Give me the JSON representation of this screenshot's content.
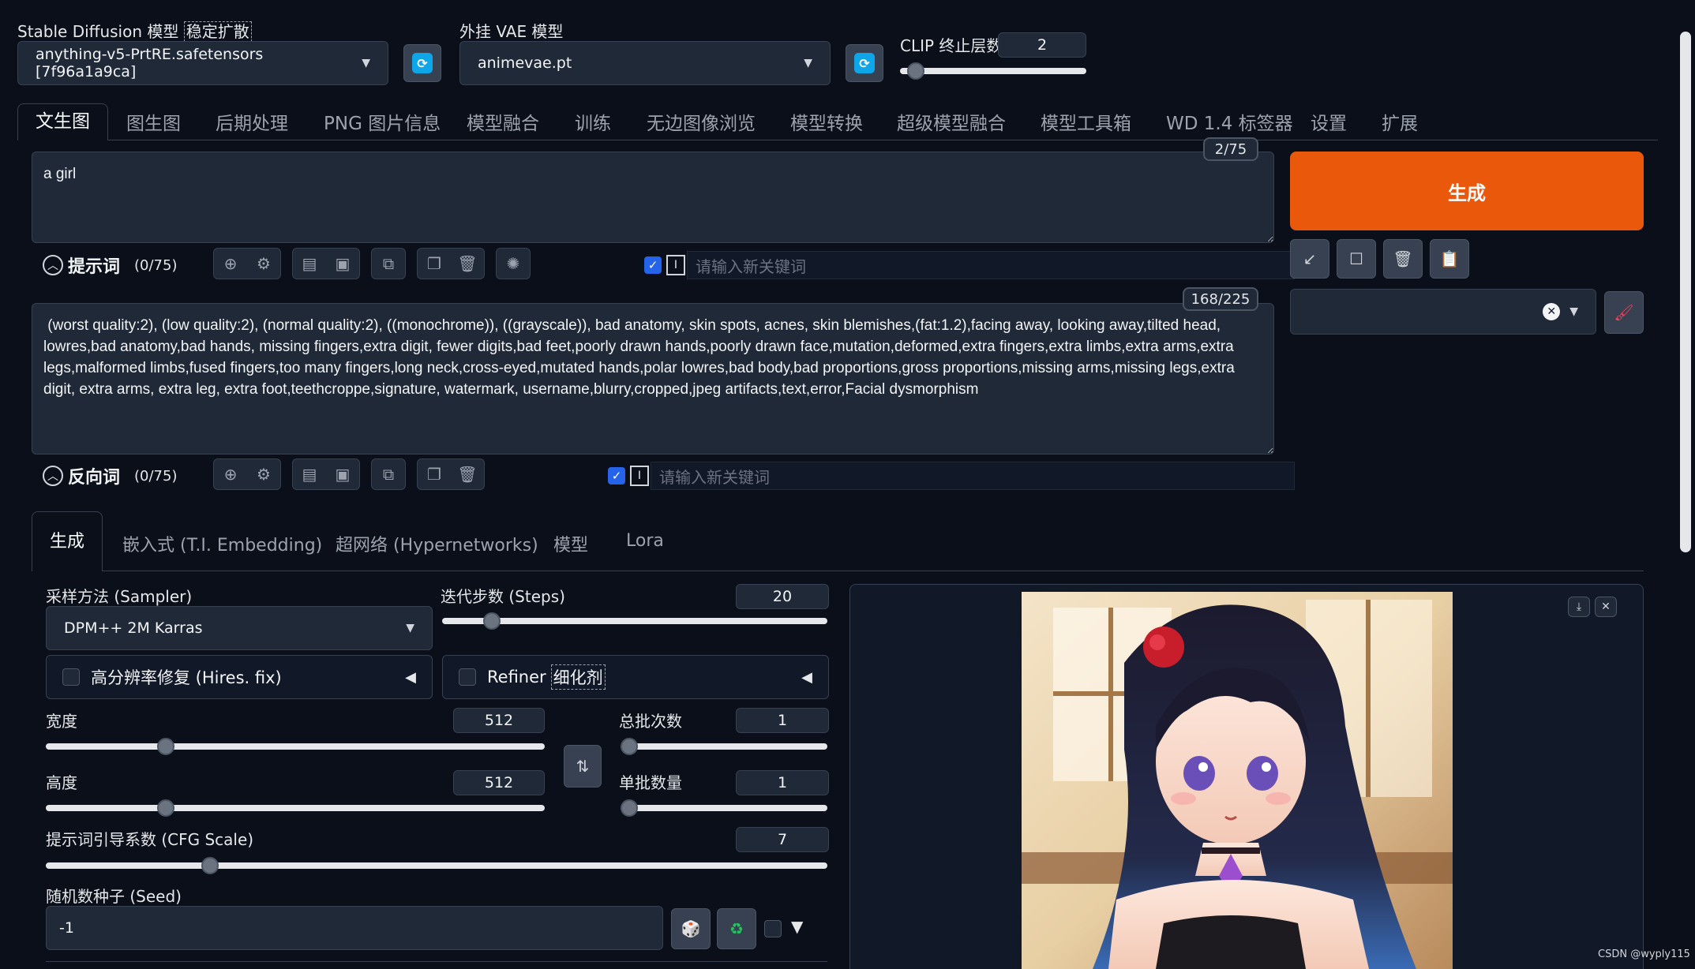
{
  "top": {
    "sd_model_label": "Stable Diffusion 模型",
    "sd_model_label_tag": "稳定扩散",
    "sd_model_value": "anything-v5-PrtRE.safetensors [7f96a1a9ca]",
    "vae_label": "外挂 VAE 模型",
    "vae_value": "animevae.pt",
    "clip_label": "CLIP 终止层数",
    "clip_value": "2",
    "clip_level": 0.083
  },
  "tabs": [
    "文生图",
    "图生图",
    "后期处理",
    "PNG 图片信息",
    "模型融合",
    "训练",
    "无边图像浏览",
    "模型转换",
    "超级模型融合",
    "模型工具箱",
    "WD 1.4 标签器",
    "设置",
    "扩展"
  ],
  "prompt": {
    "text": "a girl",
    "counter": "2/75",
    "label": "提示词",
    "count": "(0/75)",
    "keyword_placeholder": "请输入新关键词"
  },
  "negative": {
    "text": " (worst quality:2), (low quality:2), (normal quality:2), ((monochrome)), ((grayscale)), bad anatomy, skin spots, acnes, skin blemishes,(fat:1.2),facing away, looking away,tilted head, lowres,bad anatomy,bad hands, missing fingers,extra digit, fewer digits,bad feet,poorly drawn hands,poorly drawn face,mutation,deformed,extra fingers,extra limbs,extra arms,extra legs,malformed limbs,fused fingers,too many fingers,long neck,cross-eyed,mutated hands,polar lowres,bad body,bad proportions,gross proportions,missing arms,missing legs,extra digit, extra arms, extra leg, extra foot,teethcroppe,signature, watermark, username,blurry,cropped,jpeg artifacts,text,error,Facial dysmorphism",
    "counter": "168/225",
    "label": "反向词",
    "count": "(0/75)",
    "keyword_placeholder": "请输入新关键词"
  },
  "generate": {
    "label": "生成"
  },
  "sub_tabs": [
    "生成",
    "嵌入式 (T.I. Embedding)",
    "超网络 (Hypernetworks)",
    "模型",
    "Lora"
  ],
  "params": {
    "sampler_label": "采样方法 (Sampler)",
    "sampler_value": "DPM++ 2M Karras",
    "steps_label": "迭代步数 (Steps)",
    "steps_value": "20",
    "steps_level": 0.13,
    "hires_label": "高分辨率修复 (Hires. fix)",
    "refiner_label": "Refiner",
    "refiner_tag": "细化剂",
    "width_label": "宽度",
    "width_value": "512",
    "width_level": 0.24,
    "height_label": "高度",
    "height_value": "512",
    "height_level": 0.24,
    "batch_count_label": "总批次数",
    "batch_count_value": "1",
    "batch_count_level": 0.0,
    "batch_size_label": "单批数量",
    "batch_size_value": "1",
    "batch_size_level": 0.0,
    "cfg_label": "提示词引导系数 (CFG Scale)",
    "cfg_value": "7",
    "cfg_level": 0.21,
    "seed_label": "随机数种子 (Seed)",
    "seed_value": "-1"
  },
  "watermark": "CSDN @wyply115"
}
